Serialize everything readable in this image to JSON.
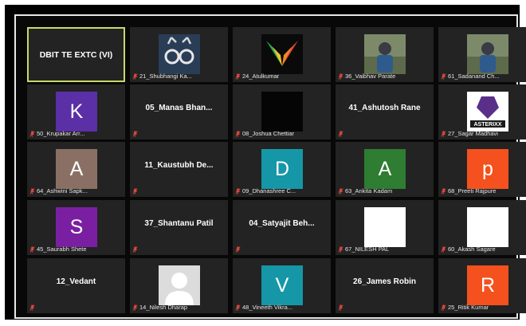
{
  "colors": {
    "tile_bg": "#232323",
    "active_border": "#c9d96a",
    "mute_red": "#e0483e"
  },
  "tiles": [
    {
      "kind": "name",
      "display": "DBIT TE EXTC (VI)",
      "label": ""
    },
    {
      "kind": "pic",
      "icon": "deer-glasses-avatar",
      "label": "21_Shubhangi Ka..."
    },
    {
      "kind": "pic",
      "icon": "colorful-wings-avatar",
      "label": "24_Atulkumar"
    },
    {
      "kind": "pic",
      "icon": "photo-avatar",
      "label": "36_Vaibhav Parate"
    },
    {
      "kind": "pic",
      "icon": "photo-avatar",
      "label": "61_Sadanand Ch..."
    },
    {
      "kind": "letter",
      "letter": "K",
      "color": "#5b2fa6",
      "label": "50_Krupakar Arr..."
    },
    {
      "kind": "name",
      "display": "05_Manas  Bhan...",
      "label": ""
    },
    {
      "kind": "pic",
      "icon": "black-avatar",
      "label": "08_Joshua Chettiar"
    },
    {
      "kind": "name",
      "display": "41_Ashutosh Rane",
      "label": ""
    },
    {
      "kind": "pic",
      "icon": "asterixx-logo-avatar",
      "label": "27_Sagar Madhavi"
    },
    {
      "kind": "letter",
      "letter": "A",
      "color": "#8a7064",
      "label": "64_Ashwini Sapk..."
    },
    {
      "kind": "name",
      "display": "11_Kaustubh  De...",
      "label": ""
    },
    {
      "kind": "letter",
      "letter": "D",
      "color": "#1697a8",
      "label": "09_Dhanashree C..."
    },
    {
      "kind": "letter",
      "letter": "A",
      "color": "#2e7d32",
      "label": "63_Ankita Kadam"
    },
    {
      "kind": "letter",
      "letter": "p",
      "color": "#f4511e",
      "label": "68_Preeti Rajpure"
    },
    {
      "kind": "letter",
      "letter": "S",
      "color": "#7b1fa2",
      "label": "45_Saurabh Shete"
    },
    {
      "kind": "name",
      "display": "37_Shantanu Patil",
      "label": ""
    },
    {
      "kind": "name",
      "display": "04_Satyajit  Beh...",
      "label": ""
    },
    {
      "kind": "pic",
      "icon": "white-avatar",
      "label": "67_NILESH PAL"
    },
    {
      "kind": "pic",
      "icon": "white-avatar",
      "label": "60_Akash Sagare"
    },
    {
      "kind": "name",
      "display": "12_Vedant",
      "label": ""
    },
    {
      "kind": "pic",
      "icon": "default-person-avatar",
      "label": "14_Nilesh Dharap"
    },
    {
      "kind": "letter",
      "letter": "V",
      "color": "#1697a8",
      "label": "48_Vineeth Vikra..."
    },
    {
      "kind": "name",
      "display": "26_James Robin",
      "label": ""
    },
    {
      "kind": "letter",
      "letter": "R",
      "color": "#f4511e",
      "label": "25_Ritik Kumar"
    }
  ]
}
